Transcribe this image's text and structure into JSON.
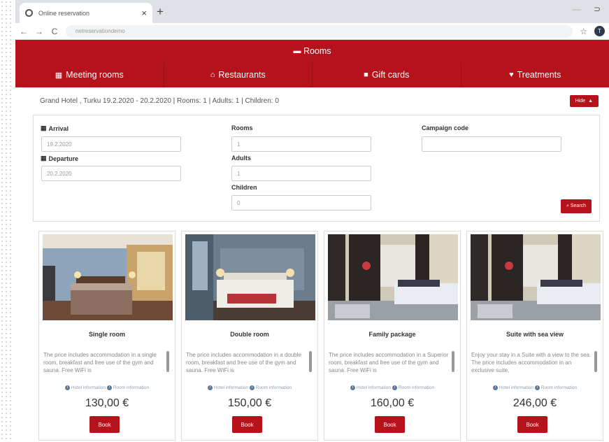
{
  "browser": {
    "tab_title": "Online reservation",
    "url": "netreservationdemo",
    "profile_initial": "T"
  },
  "nav": {
    "rooms": "Rooms",
    "meeting_rooms": "Meeting rooms",
    "restaurants": "Restaurants",
    "gift_cards": "Gift cards",
    "treatments": "Treatments"
  },
  "summary": {
    "text": "Grand Hotel , Turku 19.2.2020 - 20.2.2020 | Rooms: 1 | Adults: 1 | Children: 0",
    "hide_label": "Hide"
  },
  "form": {
    "arrival_label": "Arrival",
    "arrival_value": "19.2.2020",
    "departure_label": "Departure",
    "departure_value": "20.2.2020",
    "rooms_label": "Rooms",
    "rooms_value": "1",
    "adults_label": "Adults",
    "adults_value": "1",
    "children_label": "Children",
    "children_value": "0",
    "campaign_label": "Campaign code",
    "campaign_value": "",
    "search_label": "Search"
  },
  "rooms": [
    {
      "title": "Single room",
      "description": "The price includes accommodation in a single room, breakfast and free use of the gym and sauna. Free WiFi is",
      "hotel_info": "Hotel information",
      "room_info": "Room information",
      "price": "130,00 €",
      "book": "Book"
    },
    {
      "title": "Double room",
      "description": "The price includes accommodation in a double room, breakfast and free use of the gym and sauna. Free WiFi is",
      "hotel_info": "Hotel information",
      "room_info": "Room information",
      "price": "150,00 €",
      "book": "Book"
    },
    {
      "title": "Family package",
      "description": "The price includes accommodation in a Superior room, breakfast and free use of the gym and sauna. Free WiFi is",
      "hotel_info": "Hotel information",
      "room_info": "Room information",
      "price": "160,00 €",
      "book": "Book"
    },
    {
      "title": "Suite with sea view",
      "description": "Enjoy your stay in a Suite with a view to the sea. The price includes accommodation in an exclusive suite,",
      "hotel_info": "Hotel information",
      "room_info": "Room information",
      "price": "246,00 €",
      "book": "Book"
    }
  ],
  "colors": {
    "brand_red": "#b5121b"
  }
}
